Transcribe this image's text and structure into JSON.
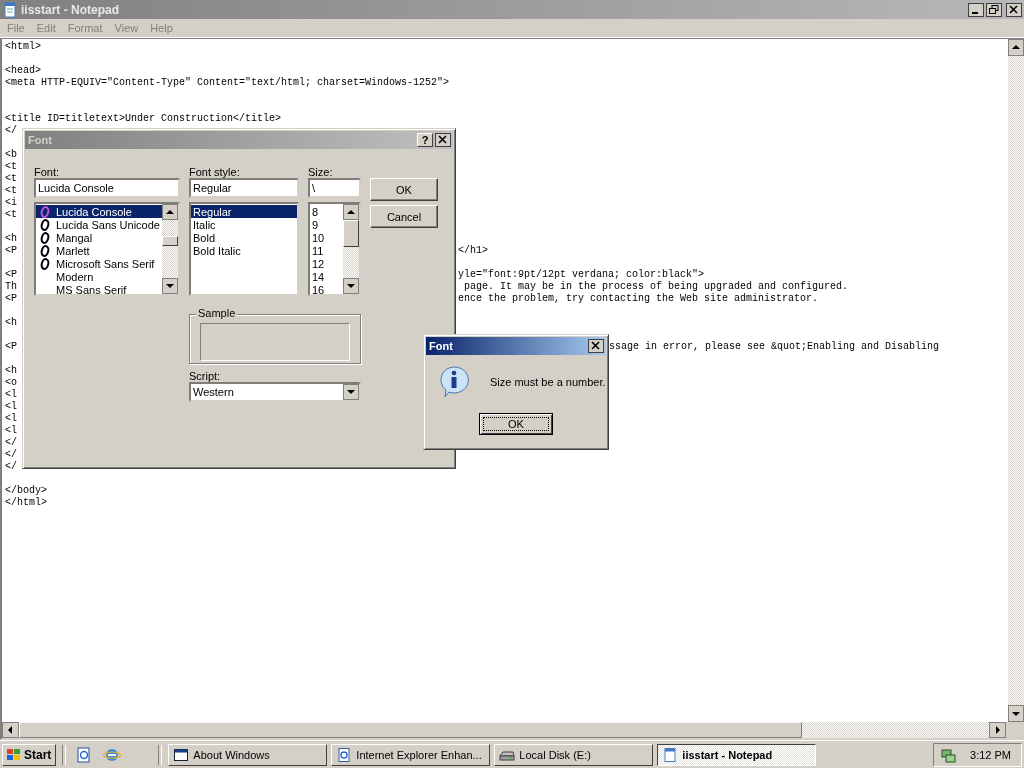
{
  "window": {
    "title": "iisstart - Notepad"
  },
  "menu": [
    {
      "label": "File"
    },
    {
      "label": "Edit"
    },
    {
      "label": "Format"
    },
    {
      "label": "View"
    },
    {
      "label": "Help"
    }
  ],
  "editor": {
    "lines": [
      {
        "kind": "full",
        "text": "<html>"
      },
      {
        "kind": "blank"
      },
      {
        "kind": "full",
        "text": "<head>"
      },
      {
        "kind": "full",
        "text": "<meta HTTP-EQUIV=\"Content-Type\" Content=\"text/html; charset=Windows-1252\">"
      },
      {
        "kind": "blank"
      },
      {
        "kind": "blank"
      },
      {
        "kind": "full",
        "text": "<title ID=titletext>Under Construction</title>"
      },
      {
        "kind": "split",
        "left": "</"
      },
      {
        "kind": "blank"
      },
      {
        "kind": "split",
        "left": "<b"
      },
      {
        "kind": "split",
        "left": "<t"
      },
      {
        "kind": "split",
        "left": "<t"
      },
      {
        "kind": "split",
        "left": "<t"
      },
      {
        "kind": "split",
        "left": "<i"
      },
      {
        "kind": "split",
        "left": "<t"
      },
      {
        "kind": "blank"
      },
      {
        "kind": "split",
        "left": "<h"
      },
      {
        "kind": "split_font",
        "left": "<P",
        "right": "</h1>"
      },
      {
        "kind": "blank"
      },
      {
        "kind": "split_font",
        "left": "<P",
        "right": "yle=\"font:9pt/12pt verdana; color:black\">"
      },
      {
        "kind": "split_font",
        "left": "Th",
        "right": " page. It may be in the process of being upgraded and configured."
      },
      {
        "kind": "split_font",
        "left": "<P",
        "right": "ence the problem, try contacting the Web site administrator."
      },
      {
        "kind": "blank"
      },
      {
        "kind": "split",
        "left": "<h"
      },
      {
        "kind": "blank"
      },
      {
        "kind": "split_message",
        "left": "<P",
        "right": "ssage in error, please see &quot;Enabling and Disabling"
      },
      {
        "kind": "blank"
      },
      {
        "kind": "split",
        "left": "<h"
      },
      {
        "kind": "split",
        "left": "<o"
      },
      {
        "kind": "split",
        "left": "<l"
      },
      {
        "kind": "split",
        "left": "<l"
      },
      {
        "kind": "split",
        "left": "<l"
      },
      {
        "kind": "split",
        "left": "<l"
      },
      {
        "kind": "split",
        "left": "</"
      },
      {
        "kind": "split",
        "left": "</"
      },
      {
        "kind": "split",
        "left": "</"
      },
      {
        "kind": "blank"
      },
      {
        "kind": "full",
        "text": "</body>"
      },
      {
        "kind": "full",
        "text": "</html>"
      }
    ]
  },
  "font_dialog": {
    "title": "Font",
    "active": false,
    "help": "?",
    "font_label": "Font:",
    "font_value": "Lucida Console",
    "fonts": [
      {
        "name": "Lucida Console",
        "kind": "opentype",
        "selected": true
      },
      {
        "name": "Lucida Sans Unicode",
        "kind": "opentype",
        "selected": false
      },
      {
        "name": "Mangal",
        "kind": "opentype",
        "selected": false
      },
      {
        "name": "Marlett",
        "kind": "opentype",
        "selected": false
      },
      {
        "name": "Microsoft Sans Serif",
        "kind": "opentype",
        "selected": false
      },
      {
        "name": "Modern",
        "kind": "plain",
        "selected": false
      },
      {
        "name": "MS Sans Serif",
        "kind": "plain",
        "selected": false
      }
    ],
    "style_label": "Font style:",
    "style_value": "Regular",
    "styles": [
      {
        "name": "Regular",
        "selected": true
      },
      {
        "name": "Italic",
        "selected": false
      },
      {
        "name": "Bold",
        "selected": false
      },
      {
        "name": "Bold Italic",
        "selected": false
      }
    ],
    "size_label": "Size:",
    "size_value": "\\",
    "sizes": [
      {
        "name": "8",
        "selected": false
      },
      {
        "name": "9",
        "selected": false
      },
      {
        "name": "10",
        "selected": false
      },
      {
        "name": "11",
        "selected": false
      },
      {
        "name": "12",
        "selected": false
      },
      {
        "name": "14",
        "selected": false
      },
      {
        "name": "16",
        "selected": false
      }
    ],
    "ok": "OK",
    "cancel": "Cancel",
    "sample_label": "Sample",
    "script_label": "Script:",
    "script_value": "Western"
  },
  "message_dialog": {
    "title": "Font",
    "active": true,
    "message": "Size must be a number.",
    "ok": "OK"
  },
  "taskbar": {
    "start": "Start",
    "tasks": [
      {
        "label": "About Windows",
        "kind": "window",
        "selected": false
      },
      {
        "label": "Internet Explorer Enhan...",
        "kind": "document",
        "selected": false
      },
      {
        "label": "Local Disk (E:)",
        "kind": "drive",
        "selected": false
      },
      {
        "label": "iisstart - Notepad",
        "kind": "notepad",
        "selected": true
      }
    ],
    "clock": "3:12 PM"
  }
}
